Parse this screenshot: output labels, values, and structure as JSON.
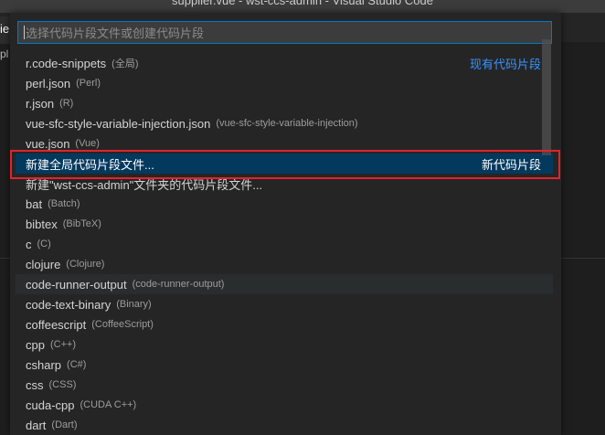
{
  "window": {
    "title": "supplier.vue - wst-ccs-admin - Visual Studio Code"
  },
  "background": {
    "left_tab_text": "ie",
    "left_text_2": "pl"
  },
  "quick_pick": {
    "placeholder": "选择代码片段文件或创建代码片段",
    "items": [
      {
        "label": "r.code-snippets",
        "desc": "(全局)",
        "separator": "现有代码片段"
      },
      {
        "label": "perl.json",
        "desc": "(Perl)",
        "separator": ""
      },
      {
        "label": "r.json",
        "desc": "(R)",
        "separator": ""
      },
      {
        "label": "vue-sfc-style-variable-injection.json",
        "desc": "(vue-sfc-style-variable-injection)",
        "separator": ""
      },
      {
        "label": "vue.json",
        "desc": "(Vue)",
        "separator": ""
      },
      {
        "label": "新建全局代码片段文件...",
        "desc": "",
        "separator": "新代码片段"
      },
      {
        "label": "新建\"wst-ccs-admin\"文件夹的代码片段文件...",
        "desc": "",
        "separator": ""
      },
      {
        "label": "bat",
        "desc": "(Batch)",
        "separator": ""
      },
      {
        "label": "bibtex",
        "desc": "(BibTeX)",
        "separator": ""
      },
      {
        "label": "c",
        "desc": "(C)",
        "separator": ""
      },
      {
        "label": "clojure",
        "desc": "(Clojure)",
        "separator": ""
      },
      {
        "label": "code-runner-output",
        "desc": "(code-runner-output)",
        "separator": ""
      },
      {
        "label": "code-text-binary",
        "desc": "(Binary)",
        "separator": ""
      },
      {
        "label": "coffeescript",
        "desc": "(CoffeeScript)",
        "separator": ""
      },
      {
        "label": "cpp",
        "desc": "(C++)",
        "separator": ""
      },
      {
        "label": "csharp",
        "desc": "(C#)",
        "separator": ""
      },
      {
        "label": "css",
        "desc": "(CSS)",
        "separator": ""
      },
      {
        "label": "cuda-cpp",
        "desc": "(CUDA C++)",
        "separator": ""
      },
      {
        "label": "dart",
        "desc": "(Dart)",
        "separator": ""
      }
    ]
  },
  "colors": {
    "accent": "#007acc",
    "selected_row": "#04395e",
    "highlight_border": "#e0242b",
    "separator_text": "#3794ff"
  }
}
